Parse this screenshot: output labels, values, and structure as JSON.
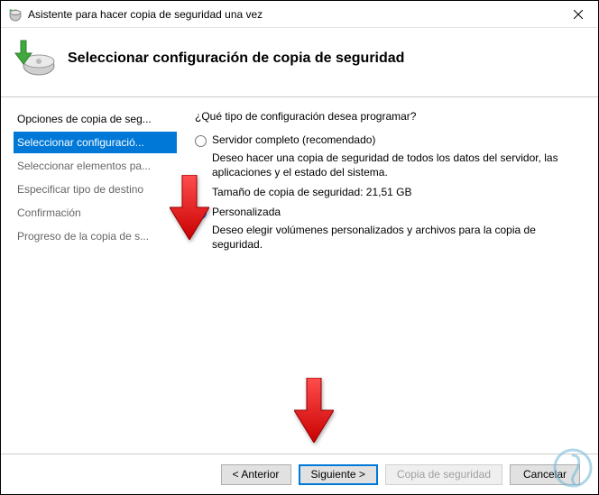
{
  "window": {
    "title": "Asistente para hacer copia de seguridad una vez"
  },
  "header": {
    "title": "Seleccionar configuración de copia de seguridad"
  },
  "sidebar": {
    "items": [
      {
        "label": "Opciones de copia de seg...",
        "state": "completed"
      },
      {
        "label": "Seleccionar configuració...",
        "state": "active"
      },
      {
        "label": "Seleccionar elementos pa...",
        "state": "pending"
      },
      {
        "label": "Especificar tipo de destino",
        "state": "pending"
      },
      {
        "label": "Confirmación",
        "state": "pending"
      },
      {
        "label": "Progreso de la copia de s...",
        "state": "pending"
      }
    ]
  },
  "main": {
    "question": "¿Qué tipo de configuración desea programar?",
    "option_full": {
      "label": "Servidor completo (recomendado)",
      "desc": "Deseo hacer una copia de seguridad de todos los datos del servidor, las aplicaciones y el estado del sistema.",
      "size_line": "Tamaño de copia de seguridad: 21,51 GB",
      "selected": false
    },
    "option_custom": {
      "label": "Personalizada",
      "desc": "Deseo elegir volúmenes personalizados y archivos para la copia de seguridad.",
      "selected": true
    }
  },
  "buttons": {
    "back": "< Anterior",
    "next": "Siguiente >",
    "backup": "Copia de seguridad",
    "cancel": "Cancelar"
  }
}
